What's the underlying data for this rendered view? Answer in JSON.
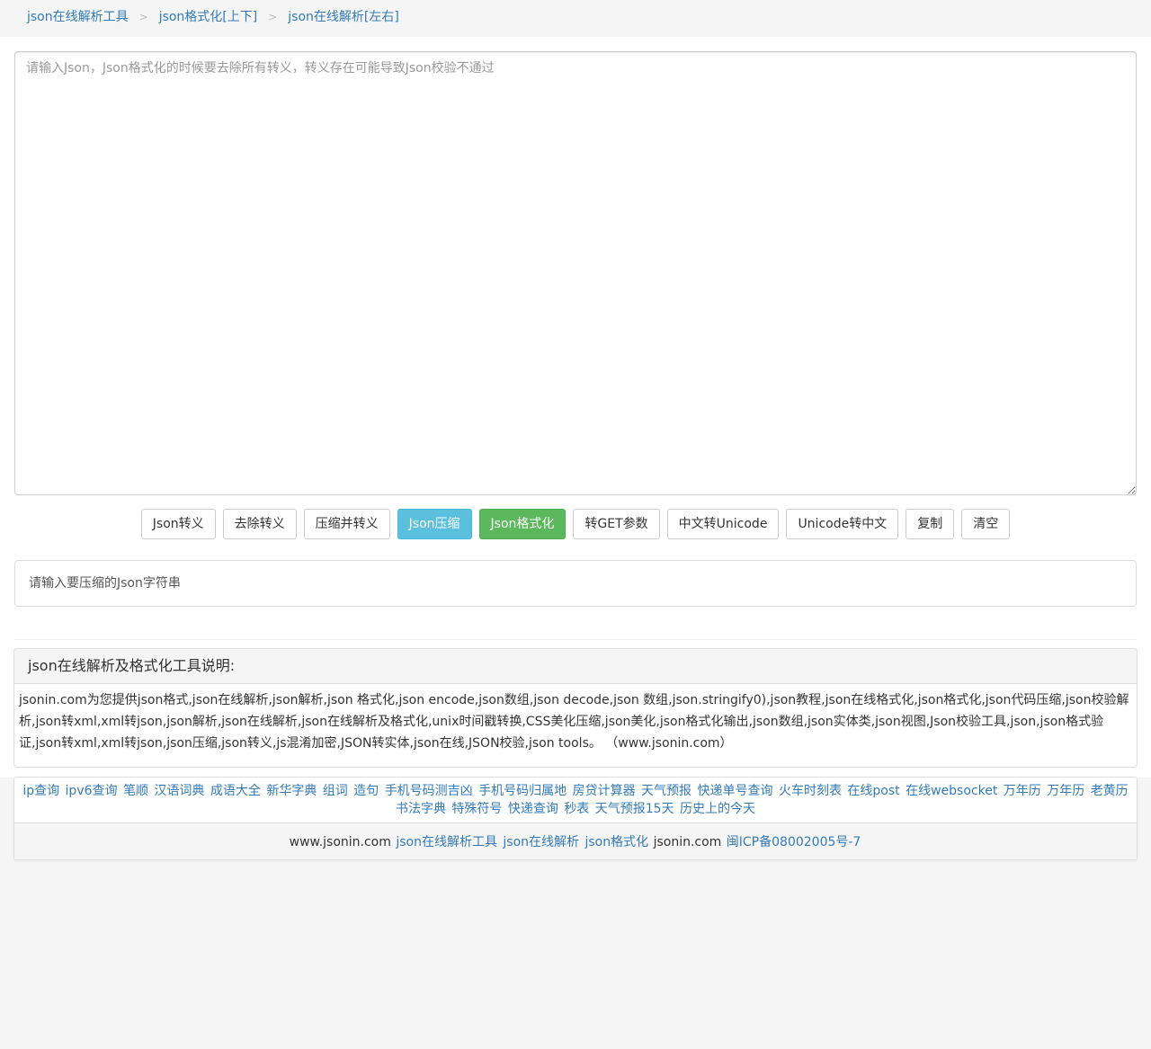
{
  "breadcrumb": {
    "items": [
      "json在线解析工具",
      "json格式化[上下]",
      "json在线解析[左右]"
    ],
    "separator": ">"
  },
  "editor": {
    "placeholder": "请输入Json，Json格式化的时候要去除所有转义，转义存在可能导致Json校验不通过"
  },
  "toolbar": {
    "buttons": [
      "Json转义",
      "去除转义",
      "压缩并转义",
      "Json压缩",
      "Json格式化",
      "转GET参数",
      "中文转Unicode",
      "Unicode转中文",
      "复制",
      "清空"
    ]
  },
  "result": {
    "text": "请输入要压缩的Json字符串"
  },
  "description": {
    "title": "json在线解析及格式化工具说明:",
    "body": "jsonin.com为您提供json格式,json在线解析,json解析,json 格式化,json encode,json数组,json decode,json 数组,json.stringify0),json教程,json在线格式化,json格式化,json代码压缩,json校验解析,json转xml,xml转json,json解析,json在线解析,json在线解析及格式化,unix时间戳转换,CSS美化压缩,json美化,json格式化输出,json数组,json实体类,json视图,Json校验工具,json,json格式验证,json转xml,xml转json,json压缩,json转义,js混淆加密,JSON转实体,json在线,JSON校验,json tools。 （www.jsonin.com）"
  },
  "links": [
    "ip查询",
    "ipv6查询",
    "笔顺",
    "汉语词典",
    "成语大全",
    "新华字典",
    "组词",
    "造句",
    "手机号码测吉凶",
    "手机号码归属地",
    "房贷计算器",
    "天气预报",
    "快递单号查询",
    "火车时刻表",
    "在线post",
    "在线websocket",
    "万年历",
    "万年历",
    "老黄历",
    "书法字典",
    "特殊符号",
    "快递查询",
    "秒表",
    "天气预报15天",
    "历史上的今天"
  ],
  "footer": {
    "site": "www.jsonin.com",
    "link1": "json在线解析工具",
    "link2": "json在线解析",
    "link3": "json格式化",
    "domain": "jsonin.com",
    "icp": "闽ICP备08002005号-7"
  }
}
